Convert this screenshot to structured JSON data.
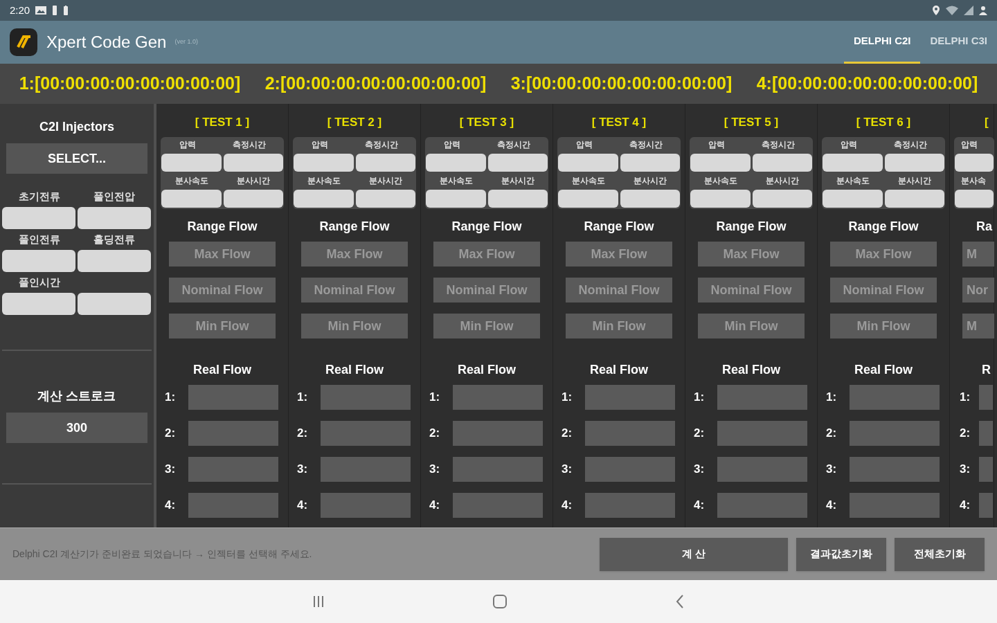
{
  "status_bar": {
    "time": "2:20"
  },
  "app_bar": {
    "title": "Xpert Code Gen",
    "version": "(ver 1.0)",
    "tabs": [
      {
        "label": "DELPHI C2I",
        "selected": true
      },
      {
        "label": "DELPHI C3I",
        "selected": false
      }
    ]
  },
  "codes": [
    "1:[00:00:00:00:00:00:00:00]",
    "2:[00:00:00:00:00:00:00:00]",
    "3:[00:00:00:00:00:00:00:00]",
    "4:[00:00:00:00:00:00:00:00]"
  ],
  "left_panel": {
    "title": "C2I Injectors",
    "select_button": "SELECT...",
    "field_rows": [
      {
        "labels": [
          "초기전류",
          "풀인전압"
        ]
      },
      {
        "labels": [
          "풀인전류",
          "홀딩전류"
        ]
      },
      {
        "labels": [
          "풀인시간"
        ]
      }
    ],
    "stroke_label": "계산 스트로크",
    "stroke_value": "300"
  },
  "tests": [
    {
      "clipped": false,
      "title": "[ TEST 1 ]",
      "field_labels": [
        "압력",
        "측정시간",
        "분사속도",
        "분사시간"
      ],
      "range_title": "Range Flow",
      "range_buttons": [
        "Max Flow",
        "Nominal Flow",
        "Min Flow"
      ],
      "real_title": "Real Flow",
      "real_rows": [
        "1:",
        "2:",
        "3:",
        "4:"
      ]
    },
    {
      "clipped": false,
      "title": "[ TEST 2 ]",
      "field_labels": [
        "압력",
        "측정시간",
        "분사속도",
        "분사시간"
      ],
      "range_title": "Range Flow",
      "range_buttons": [
        "Max Flow",
        "Nominal Flow",
        "Min Flow"
      ],
      "real_title": "Real Flow",
      "real_rows": [
        "1:",
        "2:",
        "3:",
        "4:"
      ]
    },
    {
      "clipped": false,
      "title": "[ TEST 3 ]",
      "field_labels": [
        "압력",
        "측정시간",
        "분사속도",
        "분사시간"
      ],
      "range_title": "Range Flow",
      "range_buttons": [
        "Max Flow",
        "Nominal Flow",
        "Min Flow"
      ],
      "real_title": "Real Flow",
      "real_rows": [
        "1:",
        "2:",
        "3:",
        "4:"
      ]
    },
    {
      "clipped": false,
      "title": "[ TEST 4 ]",
      "field_labels": [
        "압력",
        "측정시간",
        "분사속도",
        "분사시간"
      ],
      "range_title": "Range Flow",
      "range_buttons": [
        "Max Flow",
        "Nominal Flow",
        "Min Flow"
      ],
      "real_title": "Real Flow",
      "real_rows": [
        "1:",
        "2:",
        "3:",
        "4:"
      ]
    },
    {
      "clipped": false,
      "title": "[ TEST 5 ]",
      "field_labels": [
        "압력",
        "측정시간",
        "분사속도",
        "분사시간"
      ],
      "range_title": "Range Flow",
      "range_buttons": [
        "Max Flow",
        "Nominal Flow",
        "Min Flow"
      ],
      "real_title": "Real Flow",
      "real_rows": [
        "1:",
        "2:",
        "3:",
        "4:"
      ]
    },
    {
      "clipped": false,
      "title": "[ TEST 6 ]",
      "field_labels": [
        "압력",
        "측정시간",
        "분사속도",
        "분사시간"
      ],
      "range_title": "Range Flow",
      "range_buttons": [
        "Max Flow",
        "Nominal Flow",
        "Min Flow"
      ],
      "real_title": "Real Flow",
      "real_rows": [
        "1:",
        "2:",
        "3:",
        "4:"
      ]
    },
    {
      "clipped": true,
      "title": "[",
      "field_labels": [
        "압력",
        "분사속"
      ],
      "range_title": "Ra",
      "range_buttons": [
        "M",
        "Nor",
        "M"
      ],
      "real_title": "R",
      "real_rows": [
        "1:",
        "2:",
        "3:",
        "4:"
      ]
    }
  ],
  "bottom_bar": {
    "message": "Delphi C2I 계산기가 준비완료 되었습니다 → 인젝터를 선택해 주세요.",
    "buttons": [
      "계 산",
      "결과값초기화",
      "전체초기화"
    ]
  }
}
